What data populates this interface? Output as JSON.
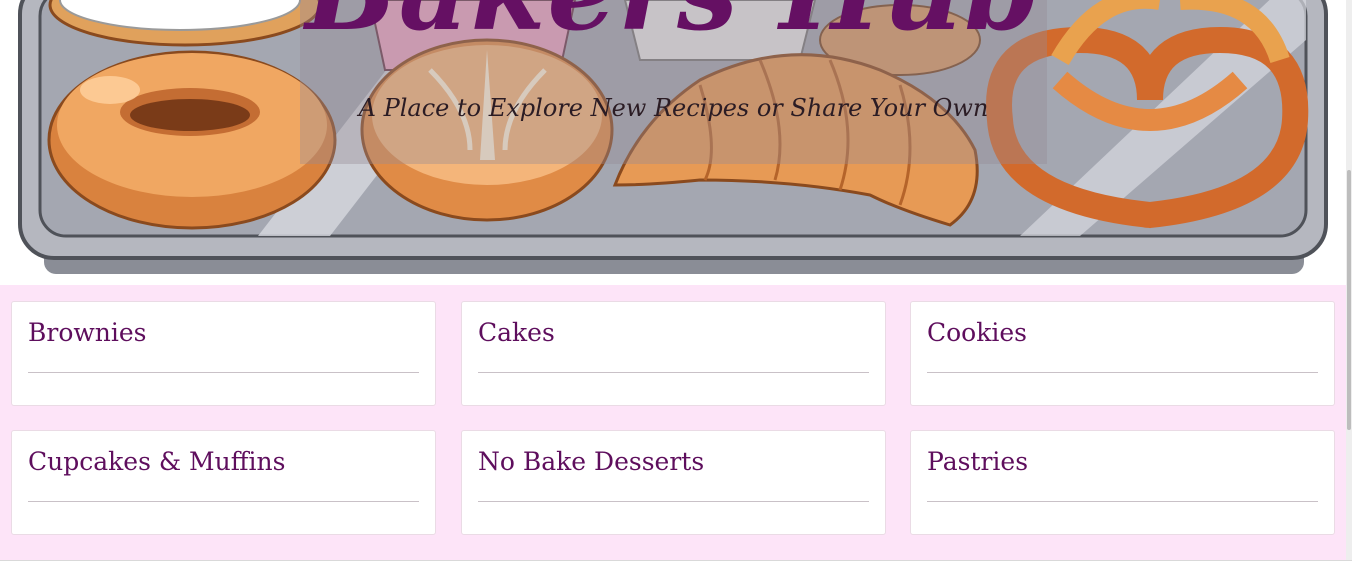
{
  "header": {
    "title": "Bakers Hub",
    "tagline": "A Place to Explore New Recipes or Share Your Own",
    "title_color": "#651063"
  },
  "hero_image": {
    "description_icons": [
      "bagel-icon",
      "bread-loaf-icon",
      "croissant-icon",
      "pretzel-icon",
      "cupcake-icon",
      "baking-tray-icon"
    ]
  },
  "categories": {
    "background": "#fde4f8",
    "items": [
      {
        "label": "Brownies"
      },
      {
        "label": "Cakes"
      },
      {
        "label": "Cookies"
      },
      {
        "label": "Cupcakes & Muffins"
      },
      {
        "label": "No Bake Desserts"
      },
      {
        "label": "Pastries"
      }
    ]
  }
}
